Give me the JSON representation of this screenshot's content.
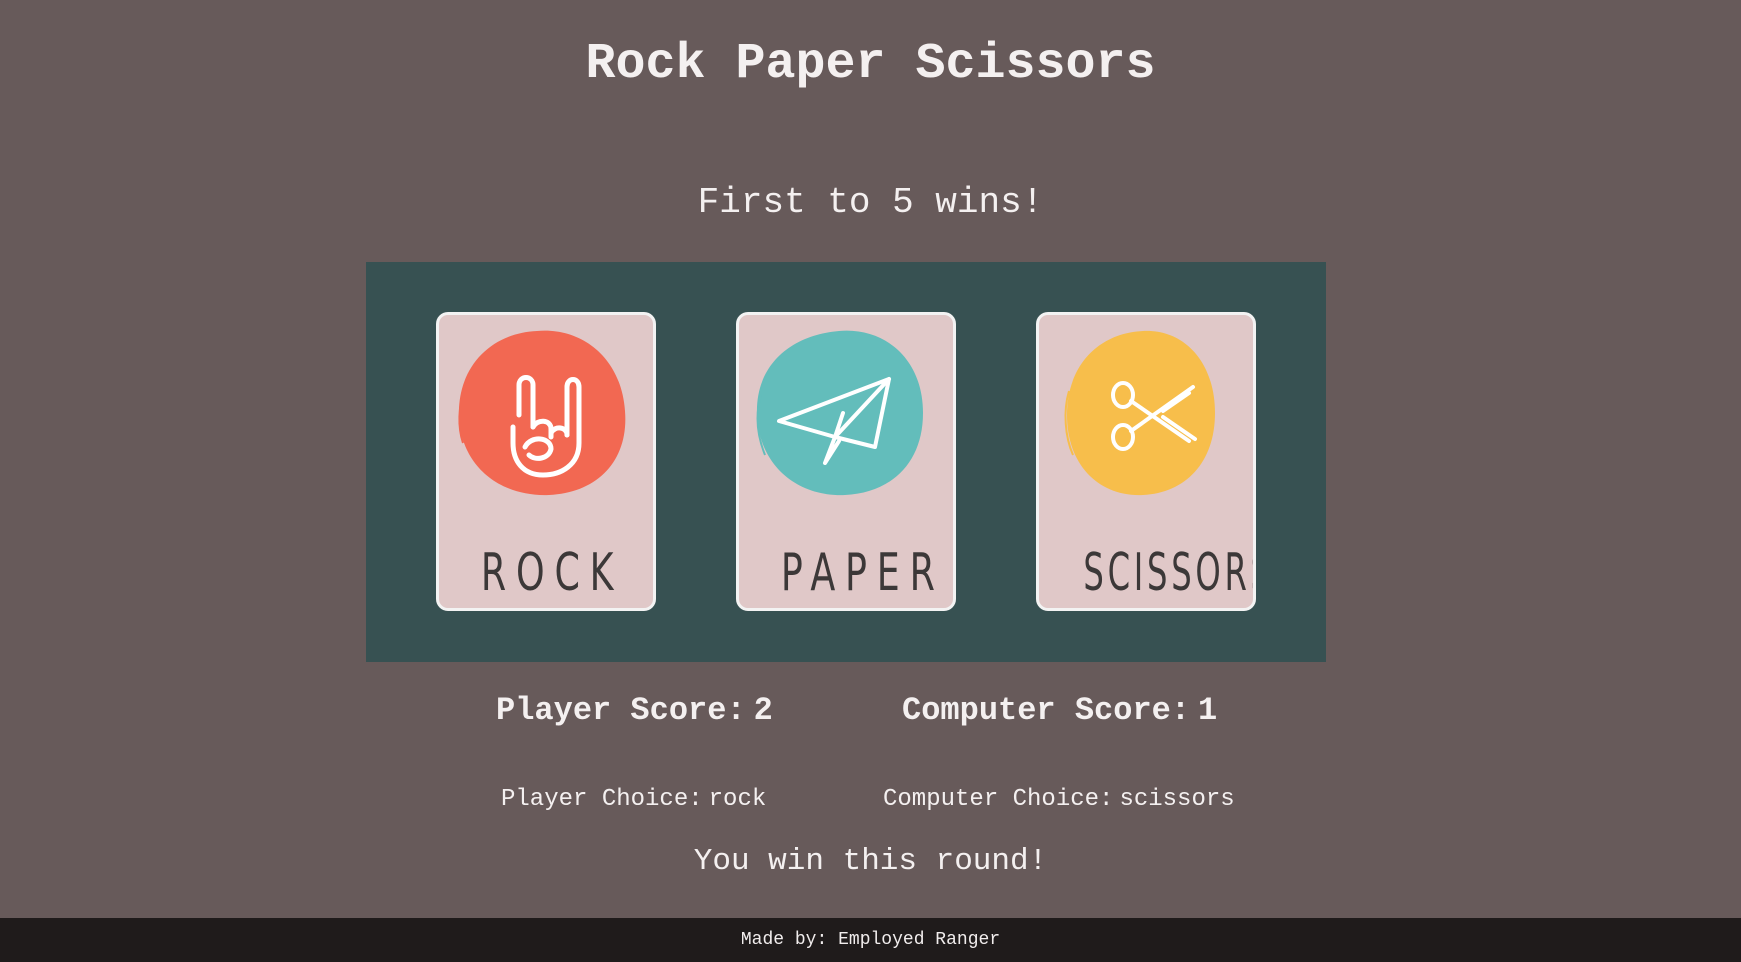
{
  "header": {
    "title": "Rock Paper Scissors",
    "subtitle": "First to 5 wins!"
  },
  "cards": [
    {
      "id": "rock",
      "label": "ROCK",
      "color": "#f26852",
      "icon": "rock-hand-icon"
    },
    {
      "id": "paper",
      "label": "PAPER",
      "color": "#63bdbb",
      "icon": "paper-plane-icon"
    },
    {
      "id": "scissors",
      "label": "SCISSORS",
      "color": "#f7be4b",
      "icon": "scissors-icon"
    }
  ],
  "scores": {
    "player_label": "Player Score:",
    "player_value": "2",
    "computer_label": "Computer Score:",
    "computer_value": "1"
  },
  "choices": {
    "player_label": "Player Choice:",
    "player_value": "rock",
    "computer_label": "Computer Choice:",
    "computer_value": "scissors"
  },
  "result": "You win this round!",
  "footer": {
    "text": "Made by: Employed Ranger"
  },
  "colors": {
    "background": "#675a5a",
    "board": "#375152",
    "card": "#e0c8c8",
    "footer": "#1f1b1b"
  }
}
